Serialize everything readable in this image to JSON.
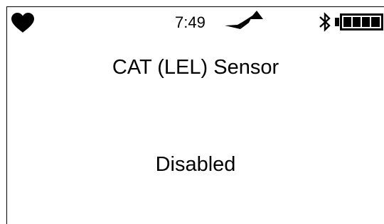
{
  "status_bar": {
    "time": "7:49",
    "icons": {
      "heartbeat": "heart-icon",
      "signal": "signal-icon",
      "bluetooth": "bluetooth-icon",
      "battery": "battery-icon"
    },
    "battery_level_percent": 100
  },
  "main": {
    "title": "CAT (LEL) Sensor",
    "status": "Disabled"
  },
  "colors": {
    "foreground": "#000000",
    "background": "#ffffff"
  }
}
